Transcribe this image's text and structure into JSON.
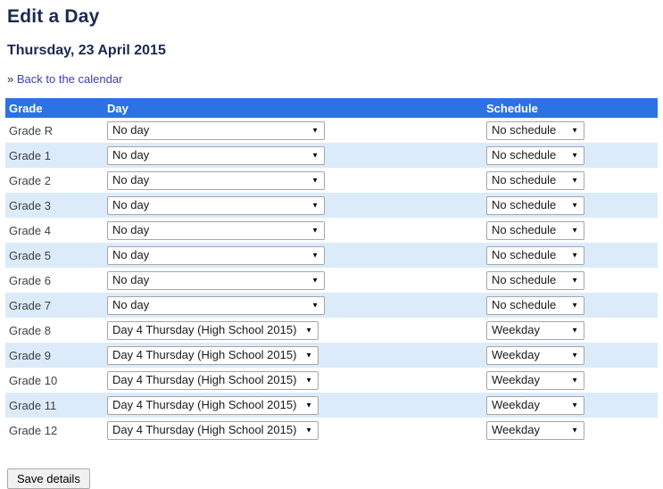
{
  "page": {
    "title": "Edit a Day",
    "date_heading": "Thursday, 23 April 2015",
    "back_link_prefix": "»",
    "back_link_label": "Back to the calendar"
  },
  "table": {
    "headers": {
      "grade": "Grade",
      "day": "Day",
      "schedule": "Schedule"
    },
    "rows": [
      {
        "grade": "Grade R",
        "day": "No day",
        "schedule": "No schedule"
      },
      {
        "grade": "Grade 1",
        "day": "No day",
        "schedule": "No schedule"
      },
      {
        "grade": "Grade 2",
        "day": "No day",
        "schedule": "No schedule"
      },
      {
        "grade": "Grade 3",
        "day": "No day",
        "schedule": "No schedule"
      },
      {
        "grade": "Grade 4",
        "day": "No day",
        "schedule": "No schedule"
      },
      {
        "grade": "Grade 5",
        "day": "No day",
        "schedule": "No schedule"
      },
      {
        "grade": "Grade 6",
        "day": "No day",
        "schedule": "No schedule"
      },
      {
        "grade": "Grade 7",
        "day": "No day",
        "schedule": "No schedule"
      },
      {
        "grade": "Grade 8",
        "day": "Day 4 Thursday (High School 2015)",
        "schedule": "Weekday"
      },
      {
        "grade": "Grade 9",
        "day": "Day 4 Thursday (High School 2015)",
        "schedule": "Weekday"
      },
      {
        "grade": "Grade 10",
        "day": "Day 4 Thursday (High School 2015)",
        "schedule": "Weekday"
      },
      {
        "grade": "Grade 11",
        "day": "Day 4 Thursday (High School 2015)",
        "schedule": "Weekday"
      },
      {
        "grade": "Grade 12",
        "day": "Day 4 Thursday (High School 2015)",
        "schedule": "Weekday"
      }
    ]
  },
  "actions": {
    "save_button_label": "Save details"
  },
  "colors": {
    "header_bg": "#2c72e4",
    "header_text": "#ffffff",
    "row_stripe_bg": "#dcebf9",
    "heading_text": "#1c2950",
    "link_text": "#3d3db5",
    "select_border": "#a6a6a6"
  }
}
